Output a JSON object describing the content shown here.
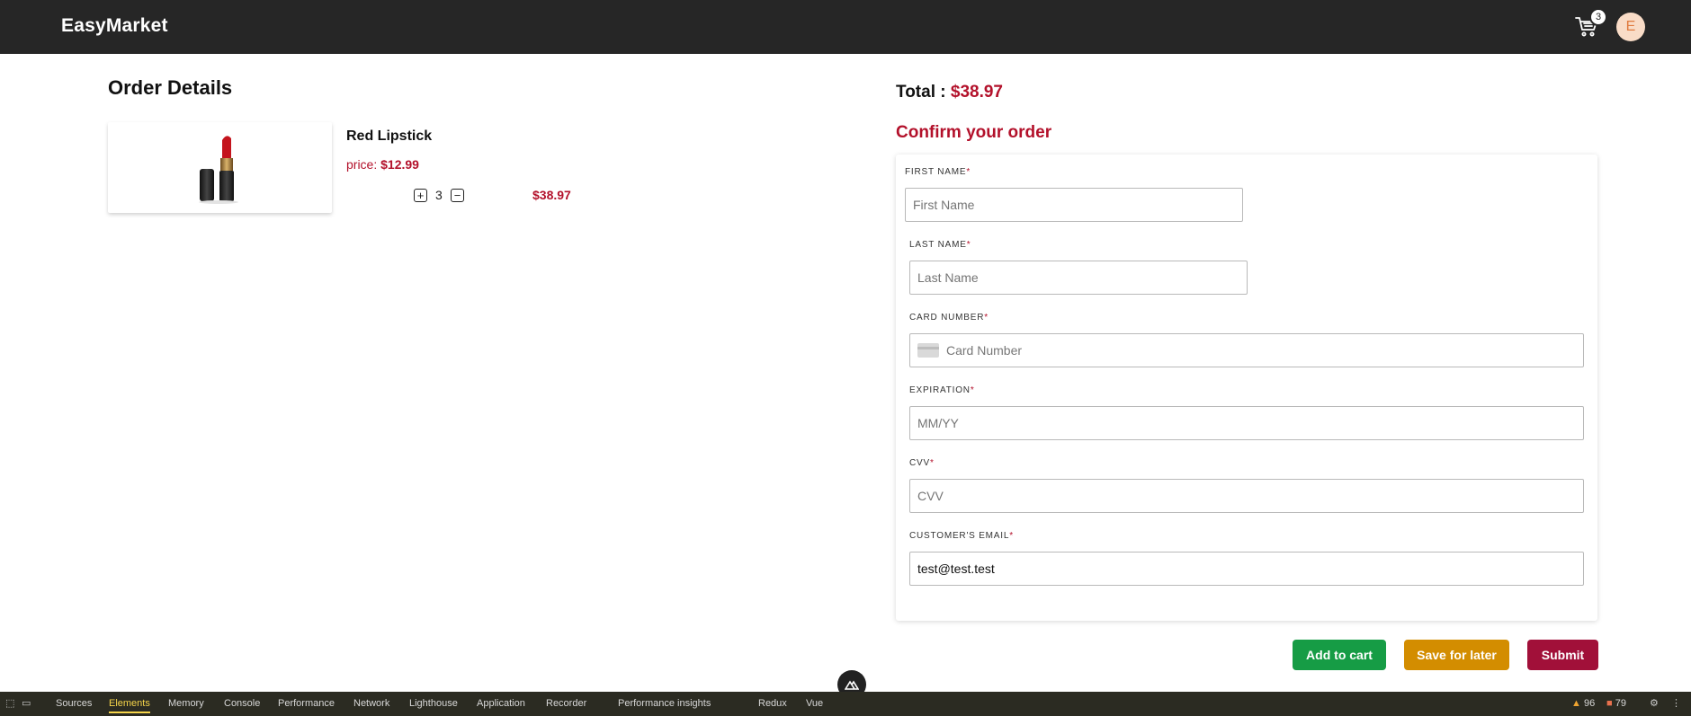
{
  "nav": {
    "brand": "EasyMarket",
    "cart_count": "3",
    "avatar_initial": "E"
  },
  "order": {
    "title": "Order Details",
    "items": [
      {
        "name": "Red Lipstick",
        "price_label": "price:",
        "price": "$12.99",
        "quantity": "3",
        "line_total": "$38.97"
      }
    ]
  },
  "checkout": {
    "total_label": "Total :",
    "total_amount": "$38.97",
    "confirm_title": "Confirm your order",
    "fields": {
      "first_name": {
        "label": "FIRST NAME",
        "placeholder": "First Name",
        "value": ""
      },
      "last_name": {
        "label": "LAST NAME",
        "placeholder": "Last Name",
        "value": ""
      },
      "card_number": {
        "label": "CARD NUMBER",
        "placeholder": "Card Number",
        "value": ""
      },
      "expiration": {
        "label": "EXPIRATION",
        "placeholder": "MM/YY",
        "value": ""
      },
      "cvv": {
        "label": "CVV",
        "placeholder": "CVV",
        "value": ""
      },
      "email": {
        "label": "CUSTOMER'S EMAIL",
        "placeholder": "",
        "value": "test@test.test"
      }
    },
    "required_mark": "*",
    "buttons": {
      "add_to_cart": "Add to cart",
      "save_for_later": "Save for later",
      "submit": "Submit"
    },
    "colors": {
      "accent_red": "#b3112b",
      "add_to_cart": "#169c45",
      "save_for_later": "#d38d00",
      "submit": "#a11039"
    }
  },
  "devtools": {
    "tabs": [
      "Sources",
      "Elements",
      "Memory",
      "Console",
      "Performance",
      "Network",
      "Lighthouse",
      "Application",
      "Recorder",
      "Performance insights",
      "Redux",
      "Vue"
    ],
    "active_tab": "Elements",
    "warnings": "96",
    "issues": "79"
  }
}
